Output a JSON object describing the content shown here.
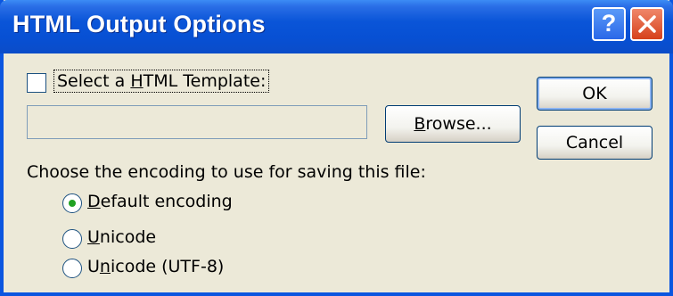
{
  "window": {
    "title": "HTML Output Options",
    "help_glyph": "?",
    "colors": {
      "titlebar": "#0750D4",
      "body": "#ECE9D8",
      "close": "#D6411C",
      "radio_selected": "#21A121"
    }
  },
  "template": {
    "checkbox_checked": false,
    "label_pre": "Select a ",
    "label_mnemonic": "H",
    "label_post": "TML Template:",
    "path_value": "",
    "browse_mnemonic": "B",
    "browse_rest": "rowse..."
  },
  "buttons": {
    "ok": "OK",
    "cancel": "Cancel"
  },
  "encoding": {
    "prompt": "Choose the encoding to use for saving this file:",
    "options": [
      {
        "mnemonic": "D",
        "rest": "efault encoding",
        "selected": true
      },
      {
        "mnemonic": "U",
        "rest": "nicode",
        "selected": false
      },
      {
        "pre": "U",
        "mnemonic": "n",
        "rest": "icode (UTF-8)",
        "selected": false
      }
    ]
  }
}
